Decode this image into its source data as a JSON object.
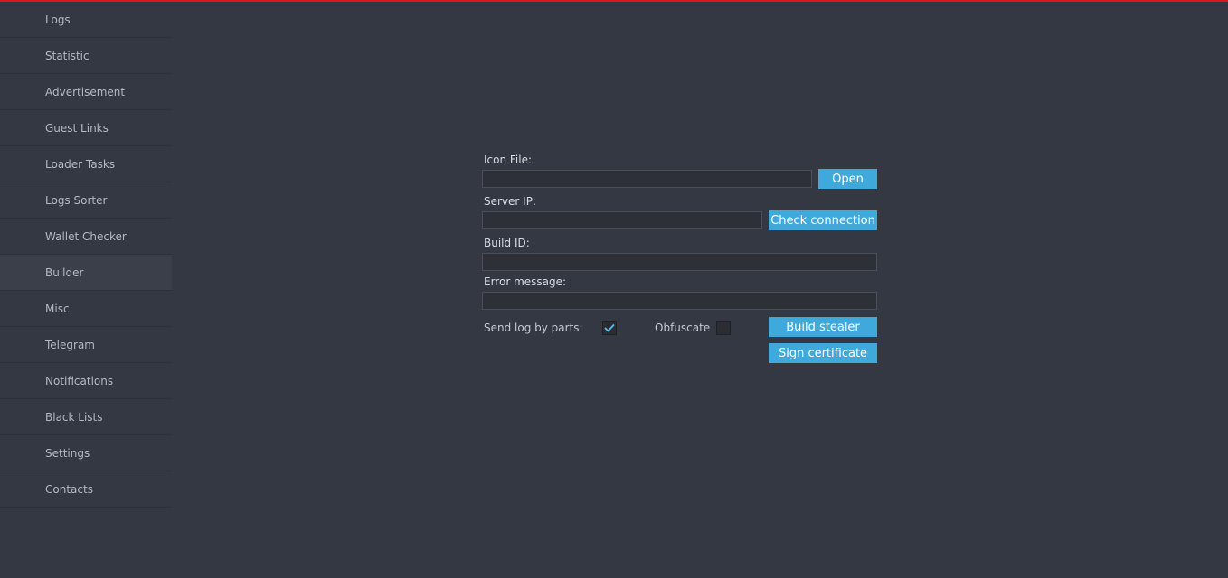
{
  "colors": {
    "background": "#343842",
    "top_accent": "#e0141b",
    "button": "#3fa9dc",
    "checkmark": "#5ac0f0"
  },
  "sidebar": {
    "active_item": "Builder",
    "items": [
      {
        "label": "Logs"
      },
      {
        "label": "Statistic"
      },
      {
        "label": "Advertisement"
      },
      {
        "label": "Guest Links"
      },
      {
        "label": "Loader Tasks"
      },
      {
        "label": "Logs Sorter"
      },
      {
        "label": "Wallet Checker"
      },
      {
        "label": "Builder"
      },
      {
        "label": "Misc"
      },
      {
        "label": "Telegram"
      },
      {
        "label": "Notifications"
      },
      {
        "label": "Black Lists"
      },
      {
        "label": "Settings"
      },
      {
        "label": "Contacts"
      }
    ]
  },
  "builder": {
    "icon_file": {
      "label": "Icon File:",
      "value": "",
      "button": "Open"
    },
    "server_ip": {
      "label": "Server IP:",
      "value": "",
      "button": "Check connection"
    },
    "build_id": {
      "label": "Build ID:",
      "value": ""
    },
    "error_message": {
      "label": "Error message:",
      "value": ""
    },
    "send_log_by_parts": {
      "label": "Send log by parts:",
      "checked": true
    },
    "obfuscate": {
      "label": "Obfuscate",
      "checked": false
    },
    "build_button": "Build stealer",
    "sign_button": "Sign certificate"
  }
}
